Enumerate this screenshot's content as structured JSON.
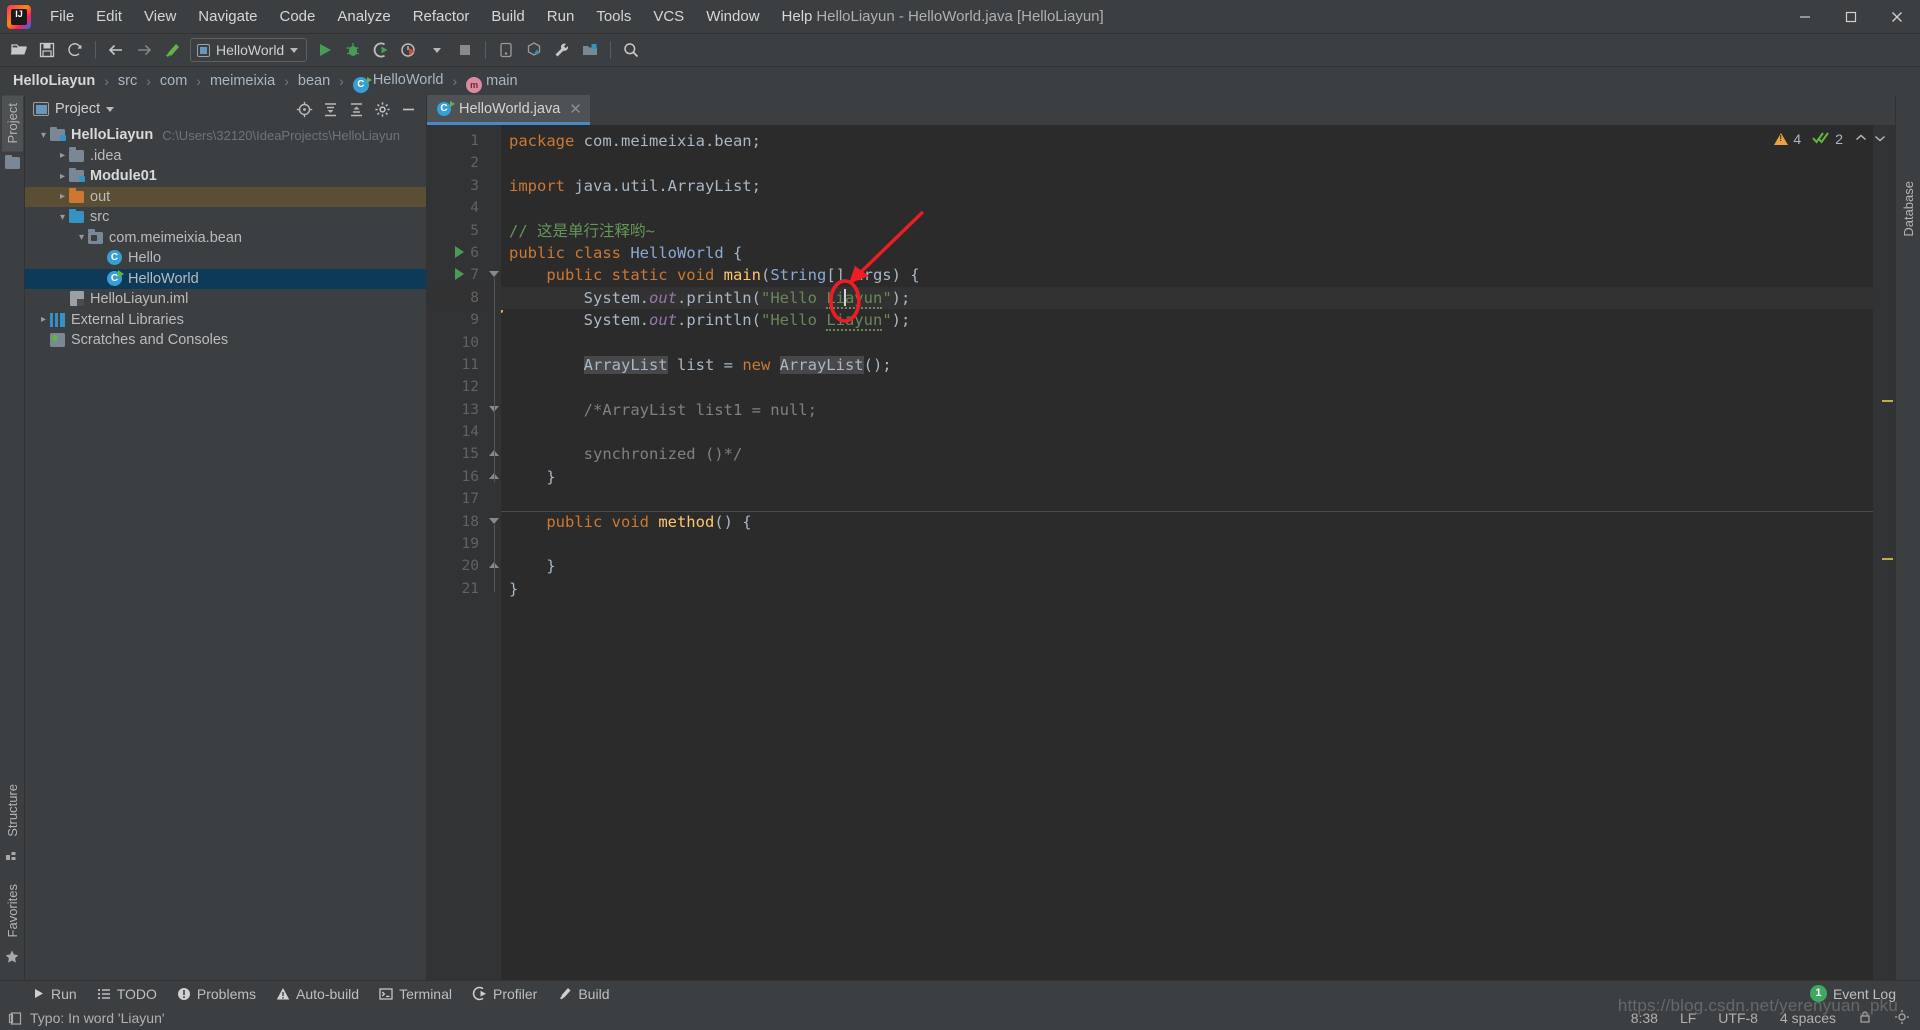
{
  "window": {
    "title": "HelloLiayun - HelloWorld.java [HelloLiayun]",
    "minimize": "–",
    "maximize": "□",
    "close": "✕",
    "logo_text": "IJ"
  },
  "menubar": {
    "items": [
      {
        "label": "File"
      },
      {
        "label": "Edit"
      },
      {
        "label": "View"
      },
      {
        "label": "Navigate"
      },
      {
        "label": "Code"
      },
      {
        "label": "Analyze"
      },
      {
        "label": "Refactor"
      },
      {
        "label": "Build"
      },
      {
        "label": "Run"
      },
      {
        "label": "Tools"
      },
      {
        "label": "VCS"
      },
      {
        "label": "Window"
      },
      {
        "label": "Help"
      }
    ]
  },
  "toolbar": {
    "run_config": "HelloWorld",
    "icons": [
      "open-folder-icon",
      "save-icon",
      "sync-icon",
      "back-arrow-icon",
      "forward-arrow-icon",
      "build-hammer-icon",
      "run-icon",
      "debug-icon",
      "run-coverage-icon",
      "run-profile-icon",
      "stop-icon",
      "device-manager-icon",
      "sdk-manager-icon",
      "settings-wrench-icon",
      "project-structure-icon",
      "search-icon"
    ]
  },
  "breadcrumb": {
    "items": [
      {
        "label": "HelloLiayun",
        "bold": true,
        "icon": null
      },
      {
        "label": "src",
        "bold": false,
        "icon": null
      },
      {
        "label": "com",
        "bold": false,
        "icon": null
      },
      {
        "label": "meimeixia",
        "bold": false,
        "icon": null
      },
      {
        "label": "bean",
        "bold": false,
        "icon": null
      },
      {
        "label": "HelloWorld",
        "bold": false,
        "icon": "class-icon"
      },
      {
        "label": "main",
        "bold": false,
        "icon": "method-icon"
      }
    ],
    "separator": "›"
  },
  "left_rail": {
    "tabs": [
      {
        "label": "Project",
        "active": true
      },
      {
        "label": "Structure",
        "active": false
      },
      {
        "label": "Favorites",
        "active": false
      }
    ]
  },
  "right_rail": {
    "tabs": [
      {
        "label": "Database"
      }
    ]
  },
  "project_panel": {
    "title": "Project",
    "tools": [
      "locate-icon",
      "expand-all-icon",
      "collapse-all-icon",
      "gear-icon",
      "hide-icon"
    ],
    "tree": [
      {
        "label": "HelloLiayun",
        "note": "C:\\Users\\32120\\IdeaProjects\\HelloLiayun",
        "depth": 0,
        "arrow": "v",
        "icon": "module-folder-icon",
        "bold": true,
        "state": "normal"
      },
      {
        "label": ".idea",
        "note": "",
        "depth": 1,
        "arrow": ">",
        "icon": "folder-icon",
        "bold": false,
        "state": "normal"
      },
      {
        "label": "Module01",
        "note": "",
        "depth": 1,
        "arrow": ">",
        "icon": "module-folder-icon",
        "bold": true,
        "state": "normal"
      },
      {
        "label": "out",
        "note": "",
        "depth": 1,
        "arrow": ">",
        "icon": "folder-orange-icon",
        "bold": false,
        "state": "highlight"
      },
      {
        "label": "src",
        "note": "",
        "depth": 1,
        "arrow": "v",
        "icon": "folder-blue-icon",
        "bold": false,
        "state": "normal"
      },
      {
        "label": "com.meimeixia.bean",
        "note": "",
        "depth": 2,
        "arrow": "v",
        "icon": "package-icon",
        "bold": false,
        "state": "normal"
      },
      {
        "label": "Hello",
        "note": "",
        "depth": 3,
        "arrow": "",
        "icon": "class-icon",
        "bold": false,
        "state": "normal"
      },
      {
        "label": "HelloWorld",
        "note": "",
        "depth": 3,
        "arrow": "",
        "icon": "runnable-class-icon",
        "bold": false,
        "state": "selected"
      },
      {
        "label": "HelloLiayun.iml",
        "note": "",
        "depth": 1,
        "arrow": "",
        "icon": "iml-file-icon",
        "bold": false,
        "state": "normal"
      },
      {
        "label": "External Libraries",
        "note": "",
        "depth": 0,
        "arrow": ">",
        "icon": "library-icon",
        "bold": false,
        "state": "normal"
      },
      {
        "label": "Scratches and Consoles",
        "note": "",
        "depth": 0,
        "arrow": "",
        "icon": "scratches-icon",
        "bold": false,
        "state": "normal"
      }
    ]
  },
  "editor": {
    "tab": {
      "label": "HelloWorld.java",
      "close": "✕",
      "icon": "runnable-class-icon"
    },
    "inspection": {
      "warnings": "4",
      "checks": "2",
      "up": "⌃",
      "down": "⌄"
    },
    "current_line": 8,
    "lines": [
      {
        "n": 1,
        "gutter": "",
        "fold": "",
        "tokens": [
          {
            "t": "package ",
            "c": "kw"
          },
          {
            "t": "com.meimeixia.bean",
            "c": "punc"
          },
          {
            "t": ";",
            "c": "punc"
          }
        ]
      },
      {
        "n": 2,
        "gutter": "",
        "fold": "",
        "tokens": []
      },
      {
        "n": 3,
        "gutter": "",
        "fold": "",
        "tokens": [
          {
            "t": "import ",
            "c": "kw"
          },
          {
            "t": "java.util.ArrayList",
            "c": "punc"
          },
          {
            "t": ";",
            "c": "punc"
          }
        ]
      },
      {
        "n": 4,
        "gutter": "",
        "fold": "",
        "tokens": []
      },
      {
        "n": 5,
        "gutter": "",
        "fold": "",
        "tokens": [
          {
            "t": "// 这是单行注释哟~",
            "c": "cmt"
          }
        ]
      },
      {
        "n": 6,
        "gutter": "run",
        "fold": "",
        "tokens": [
          {
            "t": "public class ",
            "c": "kw"
          },
          {
            "t": "HelloWorld",
            "c": "typ"
          },
          {
            "t": " {",
            "c": "punc"
          }
        ]
      },
      {
        "n": 7,
        "gutter": "run",
        "fold": "tri",
        "tokens": [
          {
            "t": "    public static void ",
            "c": "kw"
          },
          {
            "t": "main",
            "c": "mth"
          },
          {
            "t": "(",
            "c": "punc"
          },
          {
            "t": "String",
            "c": "typ"
          },
          {
            "t": "[] args) {",
            "c": "punc"
          }
        ]
      },
      {
        "n": 8,
        "gutter": "bulb",
        "fold": "",
        "tokens": [
          {
            "t": "        System.",
            "c": "punc"
          },
          {
            "t": "out",
            "c": "fld2"
          },
          {
            "t": ".println(",
            "c": "punc"
          },
          {
            "t": "\"Hello ",
            "c": "str"
          },
          {
            "t": "Liayun",
            "c": "typo"
          },
          {
            "t": "\"",
            "c": "str"
          },
          {
            "t": ");",
            "c": "punc"
          }
        ]
      },
      {
        "n": 9,
        "gutter": "",
        "fold": "",
        "tokens": [
          {
            "t": "        System.",
            "c": "punc"
          },
          {
            "t": "out",
            "c": "fld2"
          },
          {
            "t": ".println(",
            "c": "punc"
          },
          {
            "t": "\"Hello ",
            "c": "str"
          },
          {
            "t": "Liayun",
            "c": "typo"
          },
          {
            "t": "\"",
            "c": "str"
          },
          {
            "t": ");",
            "c": "punc"
          }
        ]
      },
      {
        "n": 10,
        "gutter": "",
        "fold": "",
        "tokens": []
      },
      {
        "n": 11,
        "gutter": "",
        "fold": "",
        "tokens": [
          {
            "t": "        ",
            "c": "punc"
          },
          {
            "t": "ArrayList",
            "c": "hl"
          },
          {
            "t": " list = ",
            "c": "punc"
          },
          {
            "t": "new ",
            "c": "kw"
          },
          {
            "t": "ArrayList",
            "c": "hl"
          },
          {
            "t": "();",
            "c": "punc"
          }
        ]
      },
      {
        "n": 12,
        "gutter": "",
        "fold": "",
        "tokens": []
      },
      {
        "n": 13,
        "gutter": "",
        "fold": "tri",
        "tokens": [
          {
            "t": "        /*ArrayList list1 = null;",
            "c": "grey"
          }
        ]
      },
      {
        "n": 14,
        "gutter": "",
        "fold": "",
        "tokens": []
      },
      {
        "n": 15,
        "gutter": "",
        "fold": "triup",
        "tokens": [
          {
            "t": "        synchronized ()*/",
            "c": "grey"
          }
        ]
      },
      {
        "n": 16,
        "gutter": "",
        "fold": "triup",
        "tokens": [
          {
            "t": "    }",
            "c": "punc"
          }
        ]
      },
      {
        "n": 17,
        "gutter": "",
        "fold": "",
        "tokens": []
      },
      {
        "n": 18,
        "gutter": "",
        "fold": "tri",
        "tokens": [
          {
            "t": "    public void ",
            "c": "kw"
          },
          {
            "t": "method",
            "c": "mth"
          },
          {
            "t": "() {",
            "c": "punc"
          }
        ]
      },
      {
        "n": 19,
        "gutter": "",
        "fold": "",
        "tokens": []
      },
      {
        "n": 20,
        "gutter": "",
        "fold": "triup",
        "tokens": [
          {
            "t": "    }",
            "c": "punc"
          }
        ]
      },
      {
        "n": 21,
        "gutter": "",
        "fold": "",
        "tokens": [
          {
            "t": "}",
            "c": "punc"
          }
        ]
      }
    ]
  },
  "annotation": {
    "type": "red-circle-and-arrow",
    "color": "#ee1c25",
    "target": "text-caret inside string Liayun on line 8"
  },
  "bottom_toolwindows": {
    "items": [
      {
        "label": "Run",
        "icon": "run-icon"
      },
      {
        "label": "TODO",
        "icon": "todo-icon"
      },
      {
        "label": "Problems",
        "icon": "problems-icon"
      },
      {
        "label": "Auto-build",
        "icon": "warning-icon"
      },
      {
        "label": "Terminal",
        "icon": "terminal-icon"
      },
      {
        "label": "Profiler",
        "icon": "profiler-icon"
      },
      {
        "label": "Build",
        "icon": "build-hammer-icon"
      }
    ]
  },
  "statusbar": {
    "message": "Typo: In word 'Liayun'",
    "caret_position": "8:38",
    "line_separator": "LF",
    "encoding": "UTF-8",
    "indent": "4 spaces",
    "event_log": "Event Log",
    "event_count": "1",
    "watermark": "https://blog.csdn.net/yerenyuan_pku"
  },
  "colors": {
    "accent": "#4a88c7",
    "selection": "#0d3a58",
    "annotation_red": "#ee1c25",
    "run_green": "#499c54",
    "warning_orange": "#e8a33d",
    "editor_bg": "#2b2b2b",
    "chrome_bg": "#3c3f41"
  }
}
